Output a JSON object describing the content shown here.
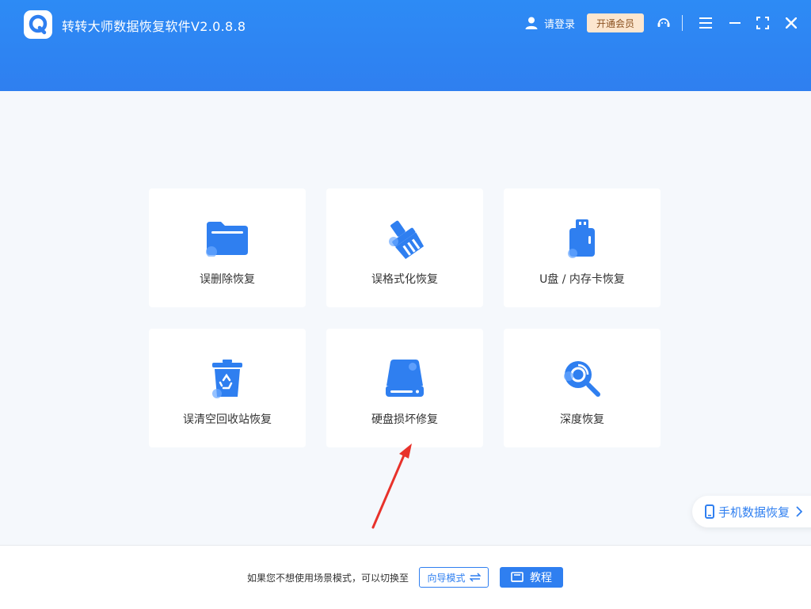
{
  "header": {
    "title": "转转大师数据恢复软件V2.0.8.8",
    "login_label": "请登录",
    "vip_label": "开通会员",
    "icons": [
      "user-icon",
      "support-icon",
      "menu-icon",
      "maximize-icon",
      "close-icon"
    ]
  },
  "cards": [
    {
      "label": "误删除恢复",
      "icon": "folder-icon"
    },
    {
      "label": "误格式化恢复",
      "icon": "broom-icon"
    },
    {
      "label": "U盘 / 内存卡恢复",
      "icon": "usb-drive-icon"
    },
    {
      "label": "误清空回收站恢复",
      "icon": "recycle-bin-icon"
    },
    {
      "label": "硬盘损坏修复",
      "icon": "hard-drive-icon"
    },
    {
      "label": "深度恢复",
      "icon": "deep-scan-icon"
    }
  ],
  "mobile_recovery": {
    "label": "手机数据恢复"
  },
  "footer": {
    "hint": "如果您不想使用场景模式，可以切换至",
    "guide_mode_label": "向导模式",
    "tutorial_label": "教程"
  },
  "colors": {
    "brand_blue": "#2f7ff0",
    "vip_bg": "#fce6cf",
    "annotation_red": "#e8322b"
  }
}
